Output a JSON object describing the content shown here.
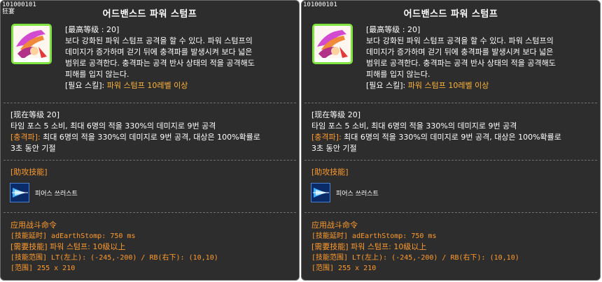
{
  "tooltips": [
    {
      "skill_id": "101000101",
      "corner_mark": "狂宴",
      "name": "어드밴스드 파워 스텀프",
      "master_level": "[最高等级 : 20]",
      "description": [
        "보다 강화된 파워 스텀프 공격을 할 수 있다. 파워 스텀프의",
        "데미지가 증가하며 걷기 뒤에 충격파를 발생시켜 보다 넓은",
        "범위로 공격한다. 충격파는 공격 반사 상태의 적을 공격해도",
        "피해를 입지 않는다."
      ],
      "required_label": "[필요 스킬]:",
      "required_value": "파워 스텀프 10레벨 이상",
      "current_level": "[现在等级 20]",
      "current_effect": "타임 포스 5 소비, 최대 6명의 적을 330%의 데미지로 9번 공격",
      "shockwave_label": "[충격파]:",
      "shockwave_text_1": "최대 6명의 적을 330%의 데미지로 9번 공격, 대상은 100%확률로",
      "shockwave_text_2": "3초 동안 기절",
      "support_header": "[助攻技能]",
      "support_skill_name": "피어스 쓰러스트",
      "command_header": "应用战斗命令",
      "delay_line": "[技能延时] adEarthStomp: 750 ms",
      "required_skill_line": "[需要技能] 파워 스텀프: 10级以上",
      "range_lines": "[技能范围] LT(左上): (-245,-200) / RB(右下): (10,10)",
      "range_size": "[范围] 255 x 210"
    },
    {
      "skill_id": "101000101",
      "corner_mark": "",
      "name": "어드밴스드 파워 스텀프",
      "master_level": "[最高等级 : 20]",
      "description": [
        "보다 강화된 파워 스텀프 공격을 할 수 있다. 파워 스텀프의",
        "데미지가 증가하며 걷기 뒤에 충격파를 발생시켜 보다 넓은",
        "범위로 공격한다. 충격파는 공격 반사 상태의 적을 공격해도",
        "피해를 입지 않는다."
      ],
      "required_label": "[필요 스킬]:",
      "required_value": "파워 스텀프 10레벨 이상",
      "current_level": "[现在等级 20]",
      "current_effect": "타임 포스 5 소비, 최대 6명의 적을 330%의 데미지로 9번 공격",
      "shockwave_label": "[충격파]:",
      "shockwave_text_1": "최대 6명의 적을 330%의 데미지로 9번 공격, 대상은 100%확률로",
      "shockwave_text_2": "3초 동안 기절",
      "support_header": "[助攻技能]",
      "support_skill_name": "피어스 쓰러스트",
      "command_header": "应用战斗命令",
      "delay_line": "[技能延时] adEarthStomp: 750 ms",
      "required_skill_line": "[需要技能] 파워 스텀프: 10级以上",
      "range_lines": "[技能范围] LT(左上): (-245,-200) / RB(右下): (10,10)",
      "range_size": "[范围] 255 x 210"
    }
  ],
  "colors": {
    "panel_bg": "#2d2d2d",
    "accent_orange": "#ff9b2f",
    "required_gold": "#ffb43a",
    "icon_border": "#7fe340"
  },
  "icons": {
    "skill_icon": "advanced-power-stomp-icon",
    "support_icon": "pierce-thrust-icon"
  }
}
